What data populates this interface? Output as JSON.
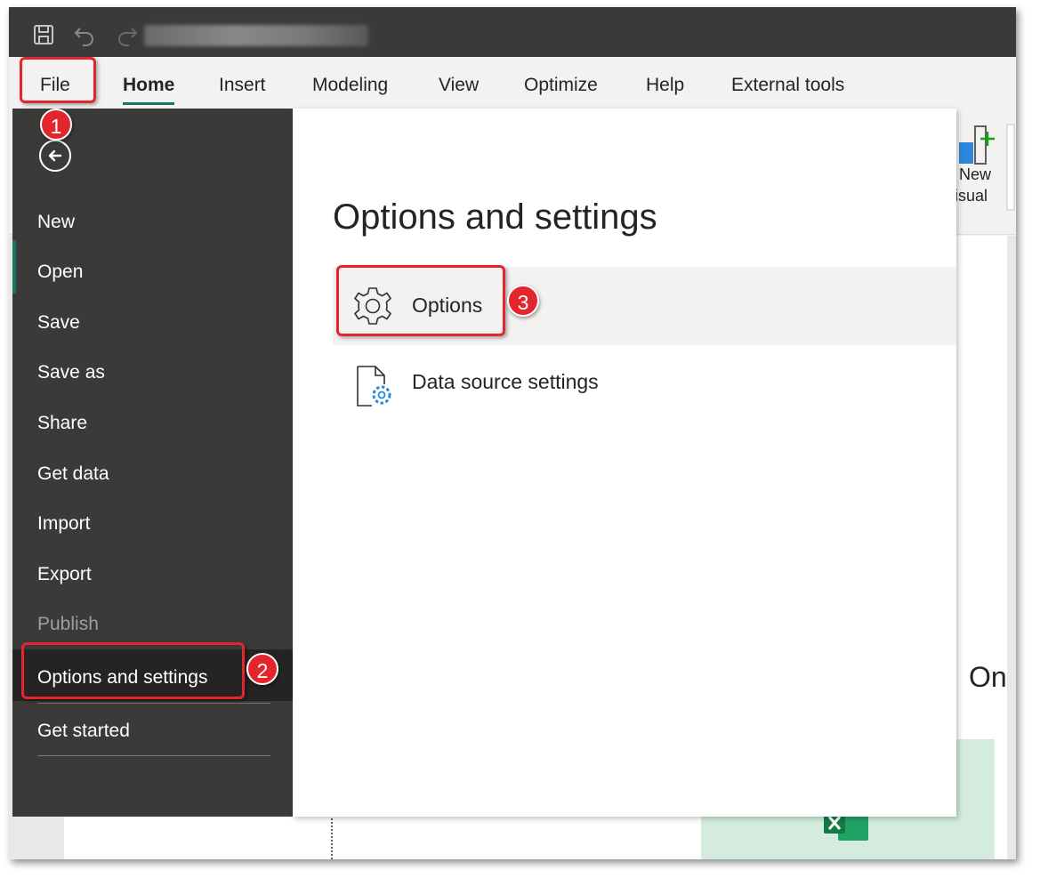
{
  "titlebar": {
    "icons": [
      "save-icon",
      "undo-icon",
      "redo-icon"
    ]
  },
  "ribbon": {
    "tabs": [
      {
        "label": "File"
      },
      {
        "label": "Home"
      },
      {
        "label": "Insert"
      },
      {
        "label": "Modeling"
      },
      {
        "label": "View"
      },
      {
        "label": "Optimize"
      },
      {
        "label": "Help"
      },
      {
        "label": "External tools"
      }
    ],
    "active_tab": "Home",
    "new_visual": {
      "line1": "New",
      "line2": "visual"
    }
  },
  "background": {
    "heading_partial": "On"
  },
  "backstage": {
    "menu": [
      {
        "label": "New"
      },
      {
        "label": "Open"
      },
      {
        "label": "Save"
      },
      {
        "label": "Save as"
      },
      {
        "label": "Share"
      },
      {
        "label": "Get data"
      },
      {
        "label": "Import"
      },
      {
        "label": "Export"
      },
      {
        "label": "Publish",
        "disabled": true
      },
      {
        "label": "Options and settings",
        "selected": true
      },
      {
        "label": "Get started"
      }
    ],
    "title": "Options and settings",
    "options": [
      {
        "label": "Options",
        "icon": "gear-icon"
      },
      {
        "label": "Data source settings",
        "icon": "data-source-settings-icon"
      }
    ]
  },
  "callouts": [
    "1",
    "2",
    "3"
  ],
  "colors": {
    "titlebar": "#3b3a39",
    "backstage_sidebar": "#3b3a39",
    "accent": "#117865",
    "callout_red": "#e3262e",
    "icon_blue": "#2b88d8"
  }
}
